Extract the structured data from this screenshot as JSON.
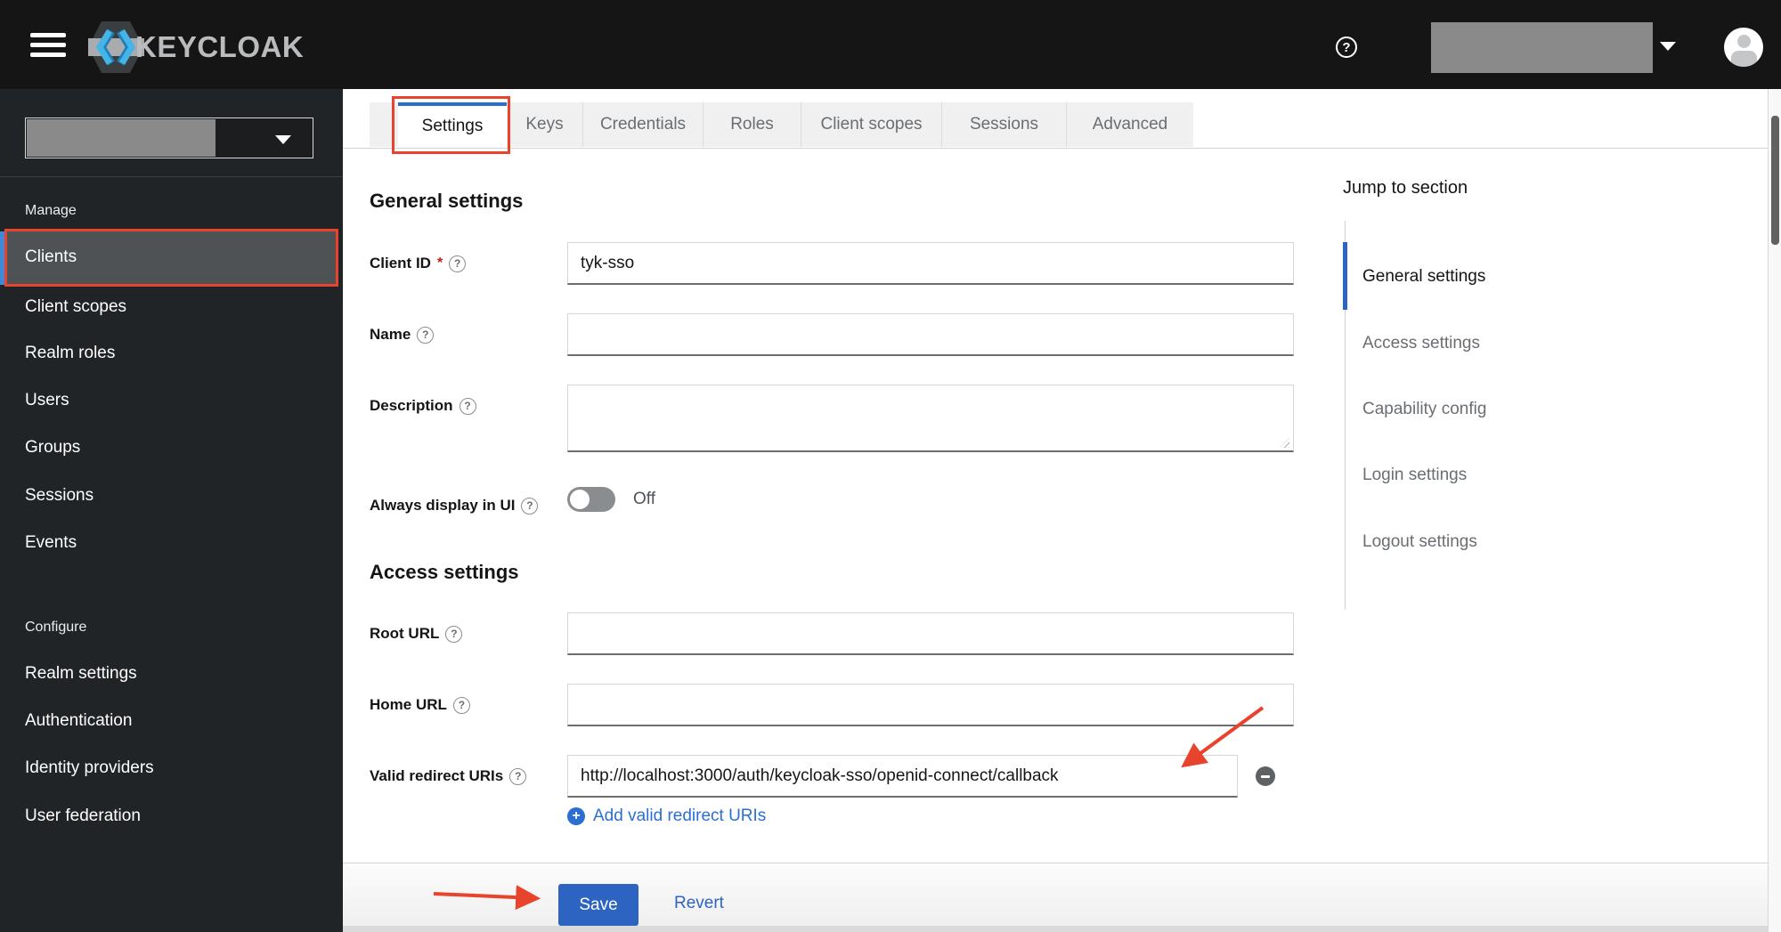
{
  "masthead": {
    "brand": "KEYCLOAK",
    "icons": {
      "menu": "hamburger-icon",
      "help": "question-circle-icon",
      "realm_dropdown": "caret-down-icon",
      "user": "avatar-icon"
    }
  },
  "sidebar": {
    "manage_label": "Manage",
    "configure_label": "Configure",
    "manage_items": [
      "Clients",
      "Client scopes",
      "Realm roles",
      "Users",
      "Groups",
      "Sessions",
      "Events"
    ],
    "configure_items": [
      "Realm settings",
      "Authentication",
      "Identity providers",
      "User federation"
    ],
    "selected_item": "Clients"
  },
  "tabs": {
    "items": [
      "Settings",
      "Keys",
      "Credentials",
      "Roles",
      "Client scopes",
      "Sessions",
      "Advanced"
    ],
    "active": "Settings"
  },
  "form": {
    "general_heading": "General settings",
    "access_heading": "Access settings",
    "client_id": {
      "label": "Client ID",
      "required": "*",
      "value": "tyk-sso"
    },
    "name": {
      "label": "Name",
      "value": ""
    },
    "description": {
      "label": "Description",
      "value": ""
    },
    "always_display": {
      "label": "Always display in UI",
      "state": "Off"
    },
    "root_url": {
      "label": "Root URL",
      "value": ""
    },
    "home_url": {
      "label": "Home URL",
      "value": ""
    },
    "valid_redirect": {
      "label": "Valid redirect URIs",
      "value": "http://localhost:3000/auth/keycloak-sso/openid-connect/callback"
    },
    "add_redirect_label": "Add valid redirect URIs"
  },
  "jump_panel": {
    "title": "Jump to section",
    "items": [
      "General settings",
      "Access settings",
      "Capability config",
      "Login settings",
      "Logout settings"
    ],
    "active": "General settings"
  },
  "footer": {
    "save": "Save",
    "revert": "Revert"
  },
  "colors": {
    "masthead_bg": "#151515",
    "sidebar_bg": "#212427",
    "annotation_red": "#e8432c",
    "primary_blue": "#2d64c1",
    "link_blue": "#2b6fd2",
    "tab_active_bar": "#2470cc",
    "nav_selected_bar": "#3f8ad8"
  }
}
